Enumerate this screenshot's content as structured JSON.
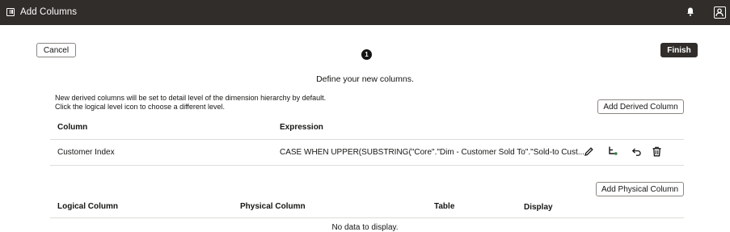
{
  "window": {
    "title": "Add Columns",
    "icons": {
      "panel": "panel-toggle-icon",
      "notifications": "bell-icon",
      "user": "user-profile-icon"
    }
  },
  "toolbar": {
    "cancel_label": "Cancel",
    "finish_label": "Finish"
  },
  "wizard": {
    "step_number": "1",
    "heading": "Define your new columns."
  },
  "derived": {
    "note_line1": "New derived columns will be set to detail level of the dimension hierarchy by default.",
    "note_line2": "Click the logical level icon to choose a different level.",
    "add_button_label": "Add Derived Column",
    "headers": {
      "column": "Column",
      "expression": "Expression"
    },
    "rows": [
      {
        "column": "Customer Index",
        "expression": "CASE WHEN UPPER(SUBSTRING(\"Core\".\"Dim - Customer Sold To\".\"Sold-to Cust...",
        "actions": [
          "edit-pencil-icon",
          "logical-level-icon",
          "undo-icon",
          "delete-trash-icon"
        ]
      }
    ]
  },
  "physical": {
    "add_button_label": "Add Physical Column",
    "headers": {
      "logical_column": "Logical Column",
      "physical_column": "Physical Column",
      "table": "Table",
      "display": "Display"
    },
    "empty_text": "No data to display."
  }
}
